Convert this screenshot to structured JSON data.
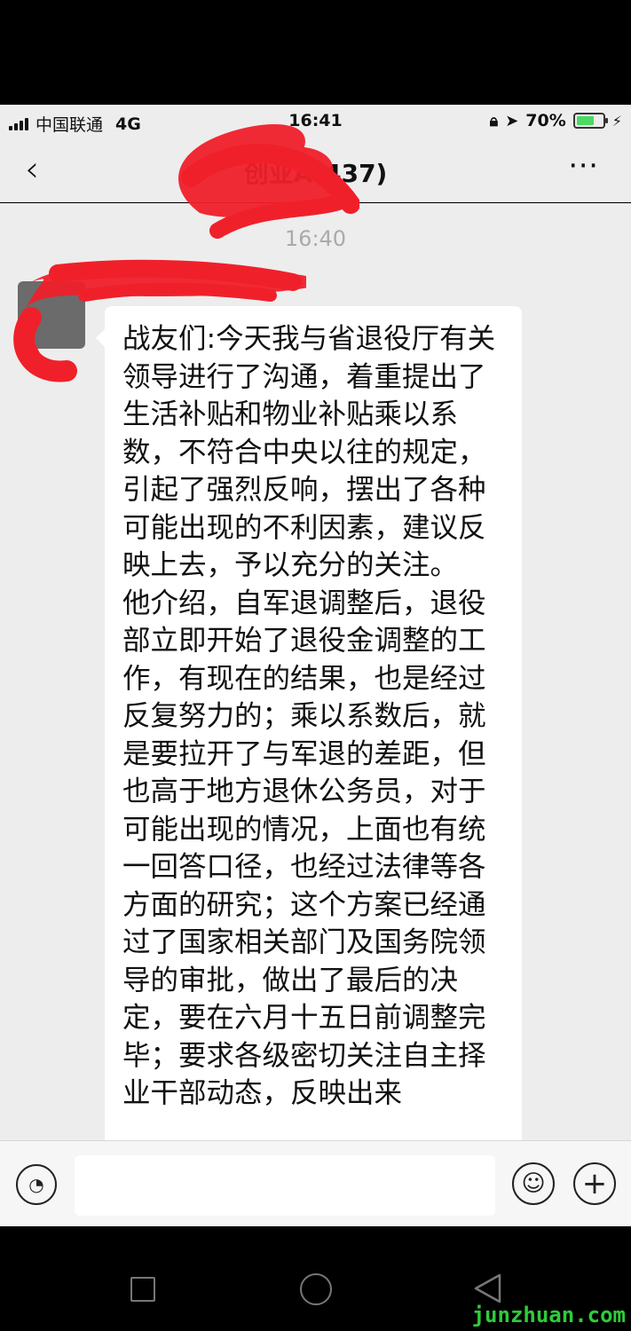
{
  "status_bar": {
    "carrier": "中国联通",
    "network": "4G",
    "time": "16:41",
    "battery_text": "70%",
    "battery_level": 0.7
  },
  "nav": {
    "back_icon": "chevron-left",
    "title": "创业A(437)",
    "more_icon": "ellipsis"
  },
  "chat": {
    "timestamp": "16:40",
    "message": "战友们:今天我与省退役厅有关领导进行了沟通，着重提出了生活补贴和物业补贴乘以系数，不符合中央以往的规定，引起了强烈反响，摆出了各种可能出现的不利因素，建议反映上去，予以充分的关注。\n他介绍，自军退调整后，退役部立即开始了退役金调整的工作，有现在的结果，也是经过反复努力的；乘以系数后，就是要拉开了与军退的差距，但也高于地方退休公务员，对于可能出现的情况，上面也有统一回答口径，也经过法律等各方面的研究；这个方案已经通过了国家相关部门及国务院领导的审批，做出了最后的决定，要在六月十五日前调整完毕；要求各级密切关注自主择业干部动态，反映出来"
  },
  "input_bar": {
    "voice_icon": "voice",
    "emoji_icon": "smiley",
    "plus_icon": "plus",
    "placeholder": ""
  },
  "android_nav": {
    "recent_icon": "square",
    "home_icon": "circle",
    "back_icon": "triangle"
  },
  "watermark": "junzhuan.com",
  "colors": {
    "redaction": "#f0202a",
    "watermark": "#2ecc3a"
  }
}
